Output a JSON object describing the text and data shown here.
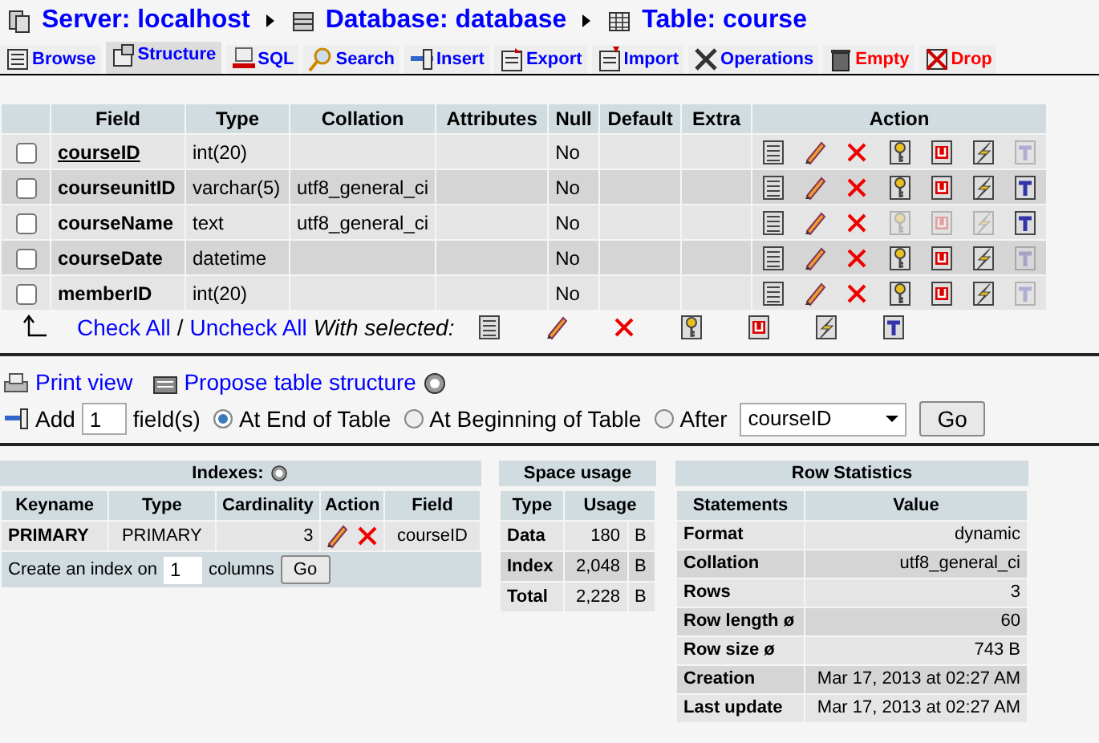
{
  "breadcrumb": [
    {
      "kind": "server",
      "label": "Server: localhost"
    },
    {
      "kind": "database",
      "label": "Database: database"
    },
    {
      "kind": "table",
      "label": "Table: course"
    }
  ],
  "tabs": [
    {
      "kind": "browse",
      "label": "Browse",
      "selected": false
    },
    {
      "kind": "structure",
      "label": "Structure",
      "selected": true
    },
    {
      "kind": "sql",
      "label": "SQL",
      "selected": false
    },
    {
      "kind": "search",
      "label": "Search",
      "selected": false
    },
    {
      "kind": "insert",
      "label": "Insert",
      "selected": false
    },
    {
      "kind": "export",
      "label": "Export",
      "selected": false
    },
    {
      "kind": "import",
      "label": "Import",
      "selected": false
    },
    {
      "kind": "operations",
      "label": "Operations",
      "selected": false
    },
    {
      "kind": "empty",
      "label": "Empty",
      "selected": false
    },
    {
      "kind": "drop",
      "label": "Drop",
      "selected": false
    }
  ],
  "structure": {
    "columns": [
      "Field",
      "Type",
      "Collation",
      "Attributes",
      "Null",
      "Default",
      "Extra",
      "Action"
    ],
    "rows": [
      {
        "field": "courseID",
        "primary": true,
        "checked": false,
        "type": "int(20)",
        "collation": "",
        "null": "No",
        "primary_disabled": false,
        "unique_disabled": false,
        "index_disabled": false,
        "fulltext_disabled": true
      },
      {
        "field": "courseunitID",
        "primary": false,
        "checked": false,
        "type": "varchar(5)",
        "collation": "utf8_general_ci",
        "null": "No",
        "primary_disabled": false,
        "unique_disabled": false,
        "index_disabled": false,
        "fulltext_disabled": false
      },
      {
        "field": "courseName",
        "primary": false,
        "checked": false,
        "type": "text",
        "collation": "utf8_general_ci",
        "null": "No",
        "primary_disabled": true,
        "unique_disabled": true,
        "index_disabled": true,
        "fulltext_disabled": false
      },
      {
        "field": "courseDate",
        "primary": false,
        "checked": false,
        "type": "datetime",
        "collation": "",
        "null": "No",
        "primary_disabled": false,
        "unique_disabled": false,
        "index_disabled": false,
        "fulltext_disabled": true
      },
      {
        "field": "memberID",
        "primary": false,
        "checked": false,
        "type": "int(20)",
        "collation": "",
        "null": "No",
        "primary_disabled": false,
        "unique_disabled": false,
        "index_disabled": false,
        "fulltext_disabled": true
      }
    ],
    "check_all": "Check All",
    "separator": "/",
    "uncheck_all": "Uncheck All",
    "with_selected": "With selected:"
  },
  "links": {
    "print_view": "Print view",
    "propose": "Propose table structure"
  },
  "add_field": {
    "label": "Add",
    "count": "1",
    "unit": "field(s)",
    "positions": [
      {
        "label": "At End of Table",
        "selected": true
      },
      {
        "label": "At Beginning of Table",
        "selected": false
      },
      {
        "label": "After",
        "selected": false
      }
    ],
    "after_field": "courseID",
    "button": "Go"
  },
  "indexes": {
    "title": "Indexes:",
    "columns": [
      "Keyname",
      "Type",
      "Cardinality",
      "Action",
      "Field"
    ],
    "rows": [
      {
        "keyname": "PRIMARY",
        "type": "PRIMARY",
        "cardinality": "3",
        "field": "courseID"
      }
    ],
    "create_label": "Create an index on",
    "create_count": "1",
    "create_unit": "columns",
    "button": "Go"
  },
  "space_usage": {
    "title": "Space usage",
    "columns": [
      "Type",
      "Usage"
    ],
    "rows": [
      {
        "type": "Data",
        "value": "180",
        "unit": "B"
      },
      {
        "type": "Index",
        "value": "2,048",
        "unit": "B"
      },
      {
        "type": "Total",
        "value": "2,228",
        "unit": "B"
      }
    ]
  },
  "row_statistics": {
    "title": "Row Statistics",
    "columns": [
      "Statements",
      "Value"
    ],
    "rows": [
      {
        "statement": "Format",
        "value": "dynamic"
      },
      {
        "statement": "Collation",
        "value": "utf8_general_ci"
      },
      {
        "statement": "Rows",
        "value": "3"
      },
      {
        "statement": "Row length ø",
        "value": "60"
      },
      {
        "statement": "Row size ø",
        "value": "743 B"
      },
      {
        "statement": "Creation",
        "value": "Mar 17, 2013 at 02:27 AM"
      },
      {
        "statement": "Last update",
        "value": "Mar 17, 2013 at 02:27 AM"
      }
    ]
  }
}
